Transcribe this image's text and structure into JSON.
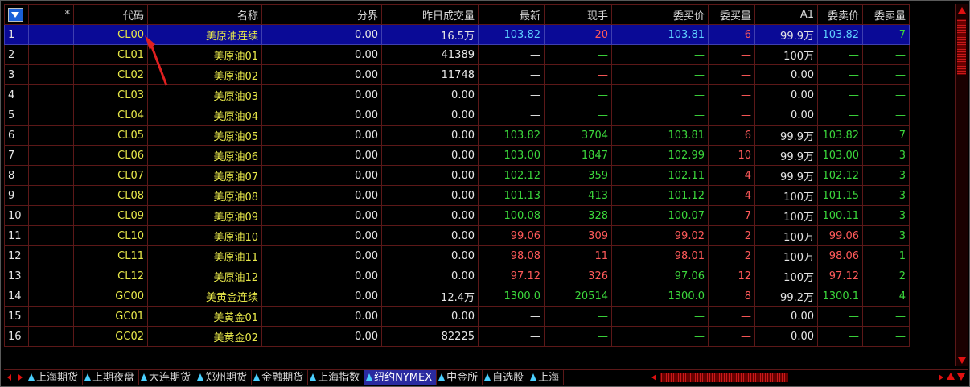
{
  "table": {
    "headers": {
      "star": "*",
      "code": "代码",
      "name": "名称",
      "boundary": "分界",
      "prev_volume": "昨日成交量",
      "last": "最新",
      "current_hand": "现手",
      "bid_price": "委买价",
      "bid_qty": "委买量",
      "a1": "A1",
      "ask_price": "委卖价",
      "ask_qty": "委卖量"
    },
    "rows": [
      {
        "idx": "1",
        "code": "CL00",
        "name": "美原油连续",
        "boundary": "0.00",
        "prev_volume": "16.5万",
        "last": "103.82",
        "current_hand": "20",
        "bid_price": "103.81",
        "bid_qty": "6",
        "a1": "99.9万",
        "ask_price": "103.82",
        "ask_qty": "7"
      },
      {
        "idx": "2",
        "code": "CL01",
        "name": "美原油01",
        "boundary": "0.00",
        "prev_volume": "41389",
        "last": "—",
        "current_hand": "—",
        "bid_price": "—",
        "bid_qty": "—",
        "a1": "100万",
        "ask_price": "—",
        "ask_qty": "—"
      },
      {
        "idx": "3",
        "code": "CL02",
        "name": "美原油02",
        "boundary": "0.00",
        "prev_volume": "11748",
        "last": "—",
        "current_hand": "—",
        "bid_price": "—",
        "bid_qty": "—",
        "a1": "0.00",
        "ask_price": "—",
        "ask_qty": "—"
      },
      {
        "idx": "4",
        "code": "CL03",
        "name": "美原油03",
        "boundary": "0.00",
        "prev_volume": "0.00",
        "last": "—",
        "current_hand": "—",
        "bid_price": "—",
        "bid_qty": "—",
        "a1": "0.00",
        "ask_price": "—",
        "ask_qty": "—"
      },
      {
        "idx": "5",
        "code": "CL04",
        "name": "美原油04",
        "boundary": "0.00",
        "prev_volume": "0.00",
        "last": "—",
        "current_hand": "—",
        "bid_price": "—",
        "bid_qty": "—",
        "a1": "0.00",
        "ask_price": "—",
        "ask_qty": "—"
      },
      {
        "idx": "6",
        "code": "CL05",
        "name": "美原油05",
        "boundary": "0.00",
        "prev_volume": "0.00",
        "last": "103.82",
        "current_hand": "3704",
        "bid_price": "103.81",
        "bid_qty": "6",
        "a1": "99.9万",
        "ask_price": "103.82",
        "ask_qty": "7"
      },
      {
        "idx": "7",
        "code": "CL06",
        "name": "美原油06",
        "boundary": "0.00",
        "prev_volume": "0.00",
        "last": "103.00",
        "current_hand": "1847",
        "bid_price": "102.99",
        "bid_qty": "10",
        "a1": "99.9万",
        "ask_price": "103.00",
        "ask_qty": "3"
      },
      {
        "idx": "8",
        "code": "CL07",
        "name": "美原油07",
        "boundary": "0.00",
        "prev_volume": "0.00",
        "last": "102.12",
        "current_hand": "359",
        "bid_price": "102.11",
        "bid_qty": "4",
        "a1": "99.9万",
        "ask_price": "102.12",
        "ask_qty": "3"
      },
      {
        "idx": "9",
        "code": "CL08",
        "name": "美原油08",
        "boundary": "0.00",
        "prev_volume": "0.00",
        "last": "101.13",
        "current_hand": "413",
        "bid_price": "101.12",
        "bid_qty": "4",
        "a1": "100万",
        "ask_price": "101.15",
        "ask_qty": "3"
      },
      {
        "idx": "10",
        "code": "CL09",
        "name": "美原油09",
        "boundary": "0.00",
        "prev_volume": "0.00",
        "last": "100.08",
        "current_hand": "328",
        "bid_price": "100.07",
        "bid_qty": "7",
        "a1": "100万",
        "ask_price": "100.11",
        "ask_qty": "3"
      },
      {
        "idx": "11",
        "code": "CL10",
        "name": "美原油10",
        "boundary": "0.00",
        "prev_volume": "0.00",
        "last": "99.06",
        "current_hand": "309",
        "bid_price": "99.02",
        "bid_qty": "2",
        "a1": "100万",
        "ask_price": "99.06",
        "ask_qty": "3"
      },
      {
        "idx": "12",
        "code": "CL11",
        "name": "美原油11",
        "boundary": "0.00",
        "prev_volume": "0.00",
        "last": "98.08",
        "current_hand": "11",
        "bid_price": "98.01",
        "bid_qty": "2",
        "a1": "100万",
        "ask_price": "98.06",
        "ask_qty": "1"
      },
      {
        "idx": "13",
        "code": "CL12",
        "name": "美原油12",
        "boundary": "0.00",
        "prev_volume": "0.00",
        "last": "97.12",
        "current_hand": "326",
        "bid_price": "97.06",
        "bid_qty": "12",
        "a1": "100万",
        "ask_price": "97.12",
        "ask_qty": "2"
      },
      {
        "idx": "14",
        "code": "GC00",
        "name": "美黄金连续",
        "boundary": "0.00",
        "prev_volume": "12.4万",
        "last": "1300.0",
        "current_hand": "20514",
        "bid_price": "1300.0",
        "bid_qty": "8",
        "a1": "99.2万",
        "ask_price": "1300.1",
        "ask_qty": "4"
      },
      {
        "idx": "15",
        "code": "GC01",
        "name": "美黄金01",
        "boundary": "0.00",
        "prev_volume": "0.00",
        "last": "—",
        "current_hand": "—",
        "bid_price": "—",
        "bid_qty": "—",
        "a1": "0.00",
        "ask_price": "—",
        "ask_qty": "—"
      },
      {
        "idx": "16",
        "code": "GC02",
        "name": "美黄金02",
        "boundary": "0.00",
        "prev_volume": "82225",
        "last": "—",
        "current_hand": "—",
        "bid_price": "—",
        "bid_qty": "—",
        "a1": "0.00",
        "ask_price": "—",
        "ask_qty": "—"
      }
    ],
    "colors": {
      "1": {
        "last": "blue",
        "current_hand": "up",
        "bid_price": "blue",
        "bid_qty": "up",
        "ask_price": "blue",
        "ask_qty": "dn"
      },
      "2": {
        "last": "plain",
        "current_hand": "dn",
        "bid_price": "dn",
        "bid_qty": "up",
        "ask_price": "dn",
        "ask_qty": "dn"
      },
      "3": {
        "last": "plain",
        "current_hand": "up",
        "bid_price": "dn",
        "bid_qty": "up",
        "ask_price": "dn",
        "ask_qty": "dn"
      },
      "4": {
        "last": "plain",
        "current_hand": "dn",
        "bid_price": "dn",
        "bid_qty": "up",
        "ask_price": "dn",
        "ask_qty": "dn"
      },
      "5": {
        "last": "plain",
        "current_hand": "dn",
        "bid_price": "dn",
        "bid_qty": "up",
        "ask_price": "dn",
        "ask_qty": "dn"
      },
      "6": {
        "last": "dn",
        "current_hand": "dn",
        "bid_price": "dn",
        "bid_qty": "up",
        "ask_price": "dn",
        "ask_qty": "dn"
      },
      "7": {
        "last": "dn",
        "current_hand": "dn",
        "bid_price": "dn",
        "bid_qty": "up",
        "ask_price": "dn",
        "ask_qty": "dn"
      },
      "8": {
        "last": "dn",
        "current_hand": "dn",
        "bid_price": "dn",
        "bid_qty": "up",
        "ask_price": "dn",
        "ask_qty": "dn"
      },
      "9": {
        "last": "dn",
        "current_hand": "dn",
        "bid_price": "dn",
        "bid_qty": "up",
        "ask_price": "dn",
        "ask_qty": "dn"
      },
      "10": {
        "last": "dn",
        "current_hand": "dn",
        "bid_price": "dn",
        "bid_qty": "up",
        "ask_price": "dn",
        "ask_qty": "dn"
      },
      "11": {
        "last": "up",
        "current_hand": "up",
        "bid_price": "up",
        "bid_qty": "up",
        "ask_price": "up",
        "ask_qty": "dn"
      },
      "12": {
        "last": "up",
        "current_hand": "up",
        "bid_price": "up",
        "bid_qty": "up",
        "ask_price": "up",
        "ask_qty": "dn"
      },
      "13": {
        "last": "up",
        "current_hand": "up",
        "bid_price": "dn",
        "bid_qty": "up",
        "ask_price": "up",
        "ask_qty": "dn"
      },
      "14": {
        "last": "dn",
        "current_hand": "dn",
        "bid_price": "dn",
        "bid_qty": "up",
        "ask_price": "dn",
        "ask_qty": "dn"
      },
      "15": {
        "last": "plain",
        "current_hand": "dn",
        "bid_price": "dn",
        "bid_qty": "up",
        "ask_price": "dn",
        "ask_qty": "dn"
      },
      "16": {
        "last": "plain",
        "current_hand": "dn",
        "bid_price": "dn",
        "bid_qty": "up",
        "ask_price": "dn",
        "ask_qty": "dn"
      }
    }
  },
  "tabs": [
    {
      "label": "上海期货",
      "active": false
    },
    {
      "label": "上期夜盘",
      "active": false
    },
    {
      "label": "大连期货",
      "active": false
    },
    {
      "label": "郑州期货",
      "active": false
    },
    {
      "label": "金融期货",
      "active": false
    },
    {
      "label": "上海指数",
      "active": false
    },
    {
      "label": "纽约NYMEX",
      "active": true
    },
    {
      "label": "中金所",
      "active": false
    },
    {
      "label": "自选股",
      "active": false
    },
    {
      "label": "上海",
      "active": false
    }
  ],
  "selected_row": "1",
  "theme": {
    "background": "#000000",
    "up_color": "#ff5a5a",
    "down_color": "#3cd83c",
    "code_color": "#e8e84a",
    "selection": "#0a0a96"
  }
}
